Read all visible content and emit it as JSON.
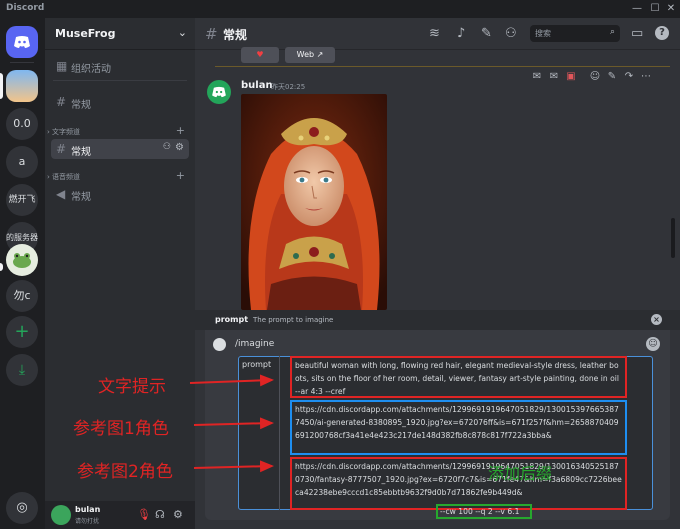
{
  "window": {
    "app_name": "Discord"
  },
  "servers": [
    {
      "label": "0.0"
    },
    {
      "label": "a"
    },
    {
      "label": "燃开飞"
    },
    {
      "label": "的服务器"
    },
    {
      "label": "勿c"
    }
  ],
  "sidebar": {
    "guild_name": "MuseFrog",
    "event_label": "组织活动",
    "channels": [
      {
        "name": "常规"
      }
    ],
    "text_category": "文字频道",
    "text_channels": [
      {
        "name": "常规"
      }
    ],
    "voice_category": "语音频道",
    "voice_channels": [
      {
        "name": "常规"
      }
    ]
  },
  "user": {
    "name": "bulan",
    "status": "请勿打扰"
  },
  "header": {
    "channel_title": "常规",
    "search_placeholder": "搜索"
  },
  "preview_buttons": {
    "web_label": "Web"
  },
  "message": {
    "author": "bulan",
    "time": "昨天02:25"
  },
  "command": {
    "option_name": "prompt",
    "option_desc": "The prompt to imagine",
    "name": "/imagine",
    "tag": "prompt",
    "text_prompt": "beautiful woman with long, flowing red hair, elegant medieval-style dress, leather boots, sits on the floor of her room, detail, viewer, fantasy art-style painting, done in oil --ar 4:3 --cref",
    "ref_url_1": "https://cdn.discordapp.com/attachments/1299691919647051829/1300153976653877450/ai-generated-8380895_1920.jpg?ex=672076ff&is=671f257f&hm=2658870409691200768cf3a41e4e423c217de148d382fb8c878c817f722a3bba&",
    "ref_url_2": "https://cdn.discordapp.com/attachments/1299691919647051829/1300163405251870730/fantasy-8777507_1920.jpg?ex=6720f7c7&is=671fe47&hm=f3a6809cc7226beeca42238ebe9cccd1c85ebbtb9632f9d0b7d71862fe9b449d&",
    "suffix": "--cw 100 --q 2 --v 6.1"
  },
  "annotations": {
    "text_prompt": "文字提示",
    "ref1": "参考图1角色",
    "ref2": "参考图2角色",
    "suffix": "添加后缀"
  },
  "colors": {
    "annotation_red": "#e02424",
    "annotation_blue": "#1e8ef0",
    "annotation_green": "#27a82e",
    "brand": "#5865f2"
  }
}
